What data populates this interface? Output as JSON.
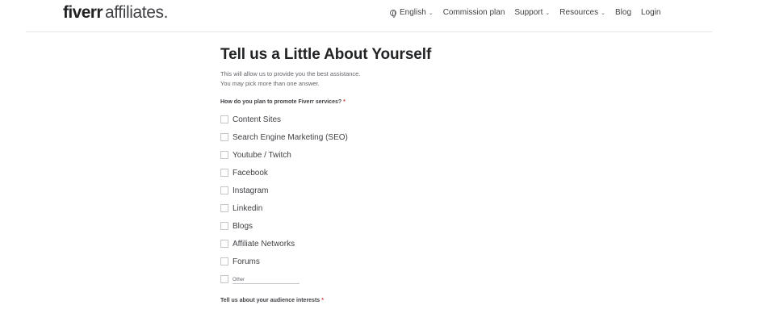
{
  "header": {
    "logo_main": "fiverr",
    "logo_sub": "affiliates.",
    "nav": [
      {
        "label": "English",
        "has_dropdown": true,
        "icon": "globe-icon"
      },
      {
        "label": "Commission plan",
        "has_dropdown": false
      },
      {
        "label": "Support",
        "has_dropdown": true
      },
      {
        "label": "Resources",
        "has_dropdown": true
      },
      {
        "label": "Blog",
        "has_dropdown": false
      },
      {
        "label": "Login",
        "has_dropdown": false
      }
    ]
  },
  "form": {
    "title": "Tell us a Little About Yourself",
    "intro_line1": "This will allow us to provide you the best assistance.",
    "intro_line2": "You may pick more than one answer.",
    "question1": "How do you plan to promote Fiverr services?",
    "required_mark": "*",
    "options": [
      "Content Sites",
      "Search Engine Marketing (SEO)",
      "Youtube / Twitch",
      "Facebook",
      "Instagram",
      "Linkedin",
      "Blogs",
      "Affiliate Networks",
      "Forums"
    ],
    "other_placeholder": "Other",
    "question2": "Tell us about your audience interests"
  },
  "colors": {
    "required": "#d03c3c",
    "text": "#404145",
    "title": "#222325",
    "border": "#c5c6c9"
  }
}
